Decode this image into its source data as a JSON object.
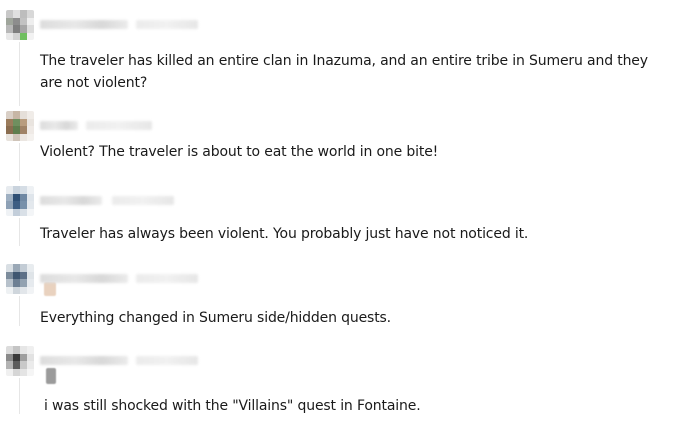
{
  "comments": [
    {
      "username": "",
      "timestamp": "",
      "text": "The traveler has killed an entire clan in Inazuma, and an entire tribe in Sumeru and they are not violent?",
      "avatar_colors": [
        "#c8c8c8",
        "#e0e0e0",
        "#bdbdbd",
        "#d8d8d8",
        "#9fa59b",
        "#8d8d8d",
        "#c2c2c2",
        "#eeeeee",
        "#b8b8b8",
        "#7e7e7e",
        "#a6a6a6",
        "#dcdcdc",
        "#e8e8e8",
        "#d2d2d2",
        "#6fbf5f",
        "#f2f2f2"
      ]
    },
    {
      "username": "",
      "timestamp": "",
      "text": "Violent? The traveler is about to eat the world in one bite!",
      "avatar_colors": [
        "#d9cfc6",
        "#c7b6a5",
        "#e5dfd9",
        "#f0ece8",
        "#9b7c5c",
        "#6f8f5f",
        "#b89c7e",
        "#e9e4df",
        "#8a6d50",
        "#5f7e4e",
        "#a08367",
        "#efeae6",
        "#e7e2dc",
        "#cfc4b9",
        "#ebe6e1",
        "#f4f1ee"
      ]
    },
    {
      "username": "",
      "timestamp": "",
      "text": "Traveler has always been violent. You probably just have not noticed it.",
      "avatar_colors": [
        "#e7ebef",
        "#c9d3dd",
        "#d5dde5",
        "#eef1f4",
        "#9fb0c2",
        "#2f4f74",
        "#6f88a3",
        "#dfe5eb",
        "#8ea1b6",
        "#3d5d82",
        "#7790aa",
        "#e3e8ed",
        "#eff2f5",
        "#c3ceda",
        "#d9e0e7",
        "#f3f5f7"
      ]
    },
    {
      "username": "",
      "timestamp": "",
      "text": "Everything changed in Sumeru side/hidden quests.",
      "avatar_colors": [
        "#d9dfe4",
        "#9aa8b6",
        "#c3ccd5",
        "#e8ecef",
        "#7c8c9c",
        "#3f5670",
        "#5d7087",
        "#dfe4e8",
        "#b7c1cb",
        "#6d7f93",
        "#93a2b1",
        "#e6eaee",
        "#eef1f3",
        "#cfd6dc",
        "#e2e6ea",
        "#f1f3f5"
      ]
    },
    {
      "username": "",
      "timestamp": "",
      "text": "i was still shocked with the \"Villains\" quest in Fontaine.",
      "avatar_colors": [
        "#dcdcdc",
        "#c4c4c4",
        "#e6e6e6",
        "#efefef",
        "#8a8a8a",
        "#3a3a3a",
        "#9e9e9e",
        "#e2e2e2",
        "#b3b3b3",
        "#5c5c5c",
        "#c9c9c9",
        "#ebebeb",
        "#f0f0f0",
        "#d6d6d6",
        "#e4e4e4",
        "#f5f5f5"
      ]
    }
  ]
}
